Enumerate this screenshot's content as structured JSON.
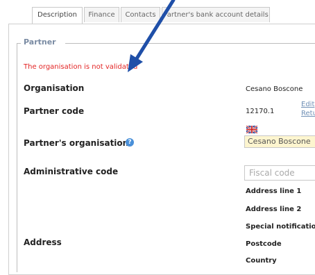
{
  "tabs": [
    {
      "label": "Description",
      "active": true
    },
    {
      "label": "Finance",
      "active": false
    },
    {
      "label": "Contacts",
      "active": false
    },
    {
      "label": "Partner's bank account details",
      "active": false
    }
  ],
  "section": {
    "legend": "Partner",
    "warning": "The organisation is not validated"
  },
  "fields": {
    "organisation_label": "Organisation",
    "organisation_value": "Cesano Boscone",
    "partner_code_label": "Partner code",
    "partner_code_value": "12170.1",
    "edit_link": "Edit",
    "ret_link": "Retu",
    "partners_org_label": "Partner's organisation",
    "partners_org_value": "Cesano Boscone",
    "admin_code_label": "Administrative code",
    "fiscal_code_placeholder": "Fiscal code",
    "address_label": "Address",
    "address_line1": "Address line 1",
    "address_line2": "Address line 2",
    "special_notification": "Special notificatio",
    "postcode": "Postcode",
    "country": "Country"
  },
  "icons": {
    "help": "help-icon",
    "flag": "uk-flag-icon",
    "arrow": "annotation-arrow"
  },
  "colors": {
    "warning": "#e32424",
    "legend": "#7a8ba3",
    "link": "#6f8fb5",
    "arrow": "#1f4fa8",
    "highlight_field": "#fdf5cf"
  }
}
